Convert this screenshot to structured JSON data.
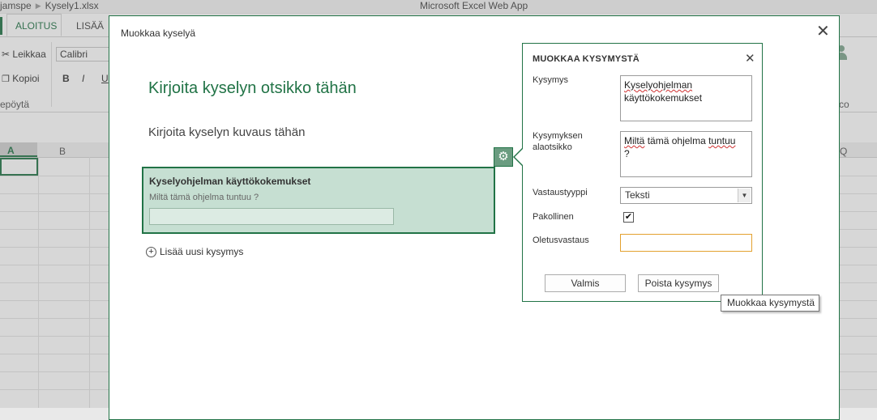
{
  "excel": {
    "breadcrumb": [
      "jamspe",
      "Kysely1.xlsx"
    ],
    "app_title": "Microsoft Excel Web App",
    "tabs": [
      "ALOITUS",
      "LISÄÄ"
    ],
    "clipboard": {
      "cut": "Leikkaa",
      "copy": "Kopioi",
      "group": "epöytä"
    },
    "font": {
      "name": "Calibri",
      "bold": "B",
      "italic": "I",
      "underline": "U"
    },
    "ribbon_right_group": "co",
    "columns": [
      "A",
      "B",
      "Q"
    ],
    "accent": "#217346"
  },
  "dialog": {
    "title": "Muokkaa kyselyä",
    "survey_title": "Kirjoita kyselyn otsikko tähän",
    "survey_description": "Kirjoita kyselyn kuvaus tähän",
    "question": {
      "label": "Kyselyohjelman käyttökokemukset",
      "subtitle": "Miltä tämä ohjelma tuntuu ?"
    },
    "add_question": "Lisää uusi kysymys"
  },
  "edit_panel": {
    "title": "MUOKKAA KYSYMYSTÄ",
    "question_label": "Kysymys",
    "question_value_line1": "Kyselyohjelman",
    "question_value_line2": "käyttökokemukset",
    "subtitle_label_line1": "Kysymyksen",
    "subtitle_label_line2": "alaotsikko",
    "subtitle_value_w1": "Miltä",
    "subtitle_value_w2": "tämä",
    "subtitle_value_w3": "ohjelma",
    "subtitle_value_w4": "tuntuu",
    "subtitle_value_line2": "?",
    "response_type_label": "Vastaustyyppi",
    "response_type_value": "Teksti",
    "required_label": "Pakollinen",
    "required_checked": true,
    "default_label": "Oletusvastaus",
    "default_value": "",
    "done_button": "Valmis",
    "delete_button": "Poista kysymys"
  },
  "tooltip": "Muokkaa kysymystä"
}
